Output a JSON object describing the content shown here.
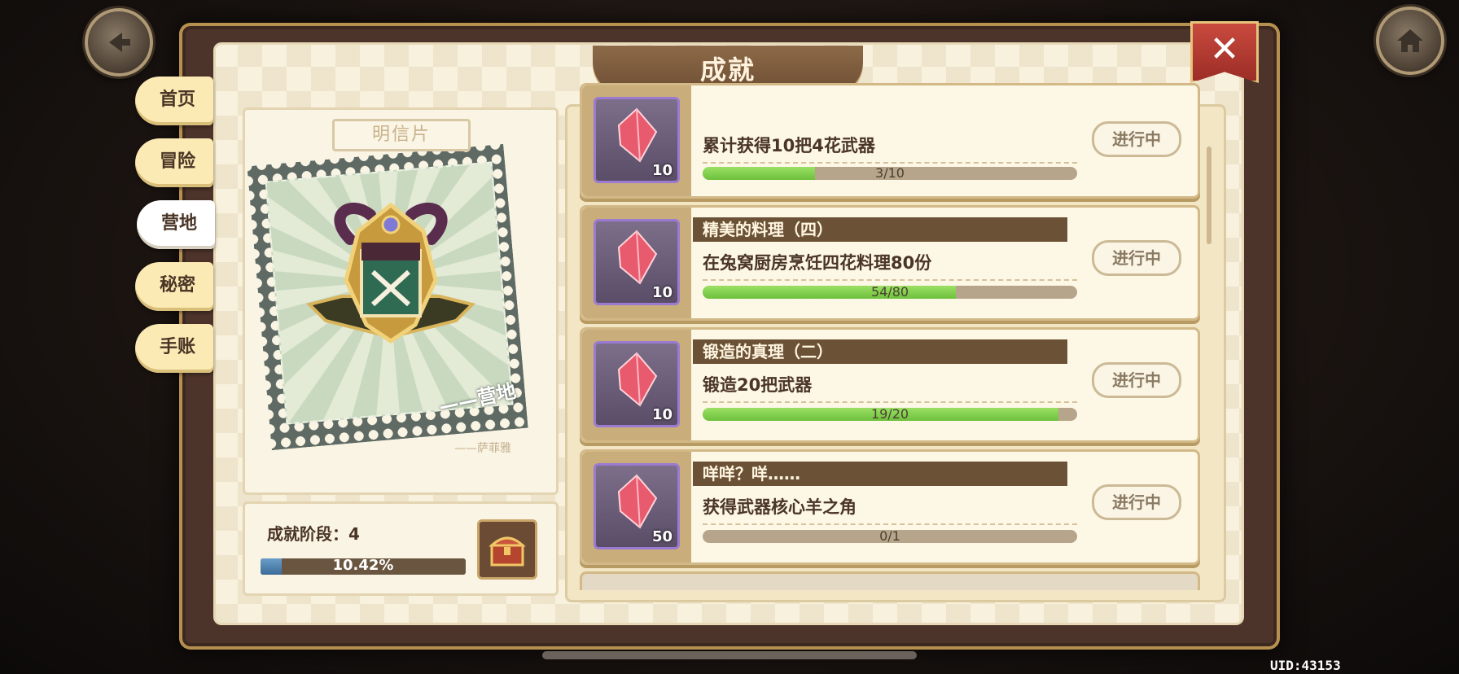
{
  "header": {
    "title": "成就",
    "close_symbol": "✕"
  },
  "nav": {
    "tabs": [
      {
        "label": "首页",
        "active": false
      },
      {
        "label": "冒险",
        "active": false
      },
      {
        "label": "营地",
        "active": true
      },
      {
        "label": "秘密",
        "active": false
      },
      {
        "label": "手账",
        "active": false
      }
    ]
  },
  "postcard": {
    "label": "明信片",
    "caption": "——营地",
    "signature": "——萨菲雅"
  },
  "progress": {
    "stage_text": "成就阶段：4",
    "percent_text": "10.42%",
    "fraction": 0.1042
  },
  "achievements": [
    {
      "title": "",
      "desc": "累计获得10把4花武器",
      "reward": "10",
      "progress_text": "3/10",
      "fraction": 0.3,
      "status": "进行中"
    },
    {
      "title": "精美的料理（四）",
      "desc": "在兔窝厨房烹饪四花料理80份",
      "reward": "10",
      "progress_text": "54/80",
      "fraction": 0.675,
      "status": "进行中"
    },
    {
      "title": "锻造的真理（二）",
      "desc": "锻造20把武器",
      "reward": "10",
      "progress_text": "19/20",
      "fraction": 0.95,
      "status": "进行中"
    },
    {
      "title": "咩咩？咩……",
      "desc": "获得武器核心羊之角",
      "reward": "50",
      "progress_text": "0/1",
      "fraction": 0.0,
      "status": "进行中"
    }
  ],
  "footer": {
    "uid": "UID:43153"
  },
  "icons": {
    "back": "back-arrow-icon",
    "home": "home-icon",
    "close": "close-icon",
    "gem": "red-gem-icon",
    "chest": "treasure-chest-icon"
  },
  "colors": {
    "accent_green": "#6dc03c",
    "progress_blue": "#3a6b98",
    "close_red": "#c94a3e"
  }
}
